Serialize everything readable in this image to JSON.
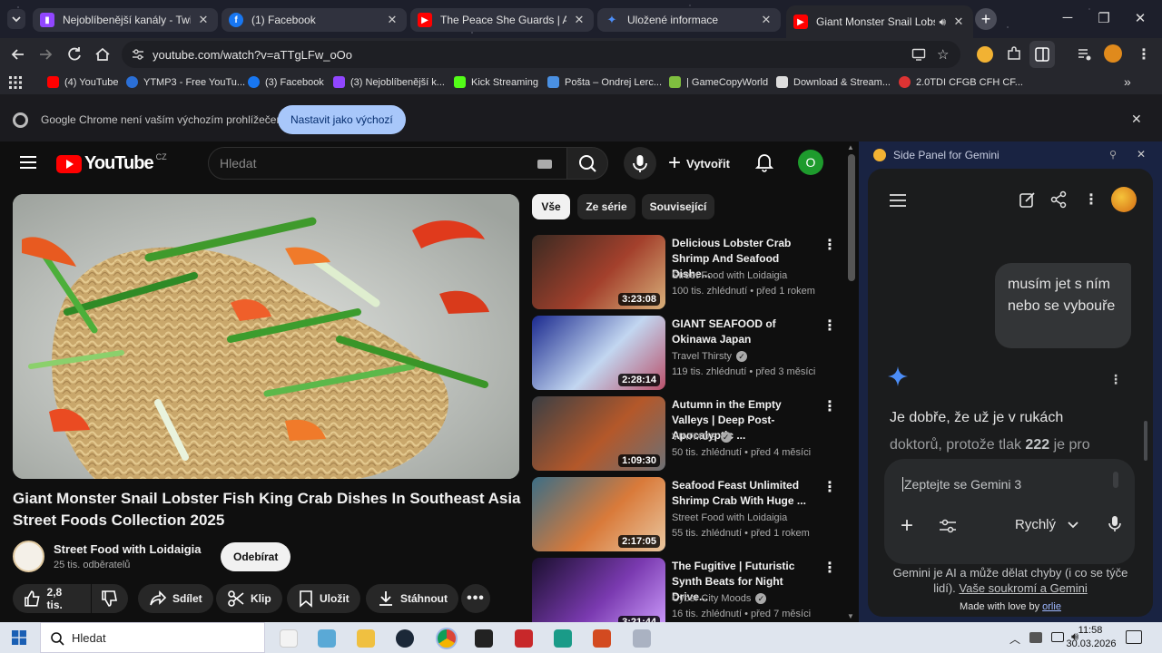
{
  "browser": {
    "tabs": [
      {
        "title": "Nejoblíbenější kanály - Twitch",
        "icon": "twitch-icon",
        "color": "#9146ff"
      },
      {
        "title": "(1) Facebook",
        "icon": "facebook-icon",
        "color": "#1877f2"
      },
      {
        "title": "The Peace She Guards | Ambient",
        "icon": "youtube-icon",
        "color": "#ff0000"
      },
      {
        "title": "Uložené informace",
        "icon": "gemini-icon",
        "color": "#4c8df6"
      },
      {
        "title": "Giant Monster Snail Lobster",
        "icon": "youtube-icon",
        "color": "#ff0000"
      }
    ],
    "url": "youtube.com/watch?v=aTTgLFw_oOo",
    "bookmarks": [
      {
        "label": "(4) YouTube",
        "color": "#ff0000"
      },
      {
        "label": "YTMP3 - Free YouTu...",
        "color": "#2b6fd6"
      },
      {
        "label": "(3) Facebook",
        "color": "#1877f2"
      },
      {
        "label": "(3) Nejoblíbenější k...",
        "color": "#9146ff"
      },
      {
        "label": "Kick Streaming",
        "color": "#53fc18"
      },
      {
        "label": "Pošta – Ondrej Lerc...",
        "color": "#4a90e2"
      },
      {
        "label": "| GameCopyWorld",
        "color": "#7fbf3f"
      },
      {
        "label": "Download & Stream...",
        "color": "#dddddd"
      },
      {
        "label": "2.0TDI CFGB CFH CF...",
        "color": "#d33"
      }
    ],
    "infobar": {
      "text": "Google Chrome není vaším výchozím prohlížečem",
      "button": "Nastavit jako výchozí"
    }
  },
  "youtube": {
    "logo": "YouTube",
    "region": "CZ",
    "search_placeholder": "Hledat",
    "create_label": "Vytvořit",
    "avatar_letter": "O",
    "video": {
      "title": "Giant Monster Snail Lobster Fish King Crab Dishes In Southeast Asia Street Foods Collection 2025",
      "channel": "Street Food with Loidaigia",
      "subscribers": "25 tis. odběratelů",
      "subscribe": "Odebírat",
      "likes": "2,8 tis.",
      "share": "Sdílet",
      "clip": "Klip",
      "save": "Uložit",
      "download": "Stáhnout"
    },
    "chips": [
      "Vše",
      "Ze série",
      "Související"
    ],
    "related": [
      {
        "title": "Delicious Lobster Crab Shrimp And Seafood Dishe...",
        "channel": "Street Food with Loidaigia",
        "verified": false,
        "meta": "100 tis. zhlédnutí • před 1 rokem",
        "duration": "3:23:08",
        "colors": [
          "#3a2a22",
          "#a3402c",
          "#d8b07a"
        ]
      },
      {
        "title": "GIANT SEAFOOD of Okinawa Japan",
        "channel": "Travel Thirsty",
        "verified": true,
        "meta": "119 tis. zhlédnutí • před 3 měsíci",
        "duration": "2:28:14",
        "colors": [
          "#1b2a8f",
          "#c2d6f0",
          "#b9506a"
        ]
      },
      {
        "title": "Autumn in the Empty Valleys | Deep Post-Apocalyptic ...",
        "channel": "VIATMOS",
        "verified": true,
        "meta": "50 tis. zhlédnutí • před 4 měsíci",
        "duration": "1:09:30",
        "colors": [
          "#3b3f44",
          "#b4582a",
          "#6c7075"
        ]
      },
      {
        "title": "Seafood Feast Unlimited Shrimp Crab With Huge ...",
        "channel": "Street Food with Loidaigia",
        "verified": false,
        "meta": "55 tis. zhlédnutí • před 1 rokem",
        "duration": "2:17:05",
        "colors": [
          "#3c6e86",
          "#d97a3a",
          "#e9c7a0"
        ]
      },
      {
        "title": "The Fugitive | Futuristic Synth Beats for Night Drive...",
        "channel": "Cyber City Moods",
        "verified": true,
        "meta": "16 tis. zhlédnutí • před 7 měsíci",
        "duration": "3:21:44",
        "colors": [
          "#1a0f2e",
          "#7a3ab0",
          "#d0a0ff"
        ]
      }
    ]
  },
  "gemini": {
    "panel_title": "Side Panel for Gemini",
    "user_message": "musím jet s ním nebo se vybouře",
    "response_line1": "Je dobře, že už je v rukách",
    "response_line2_a": "doktorů, protože tlak ",
    "response_line2_b": "222",
    "response_line2_c": " je pro",
    "input_placeholder": "Zeptejte se Gemini 3",
    "mode": "Rychlý",
    "disclaimer_1": "Gemini je AI a může dělat chyby (i co se týče",
    "disclaimer_2a": "lidí). ",
    "disclaimer_link": "Vaše soukromí a Gemini",
    "made_with": "Made with love by ",
    "made_with_link": "orlie"
  },
  "taskbar": {
    "search_placeholder": "Hledat",
    "time": "11:58",
    "date": "30.03.2026"
  }
}
